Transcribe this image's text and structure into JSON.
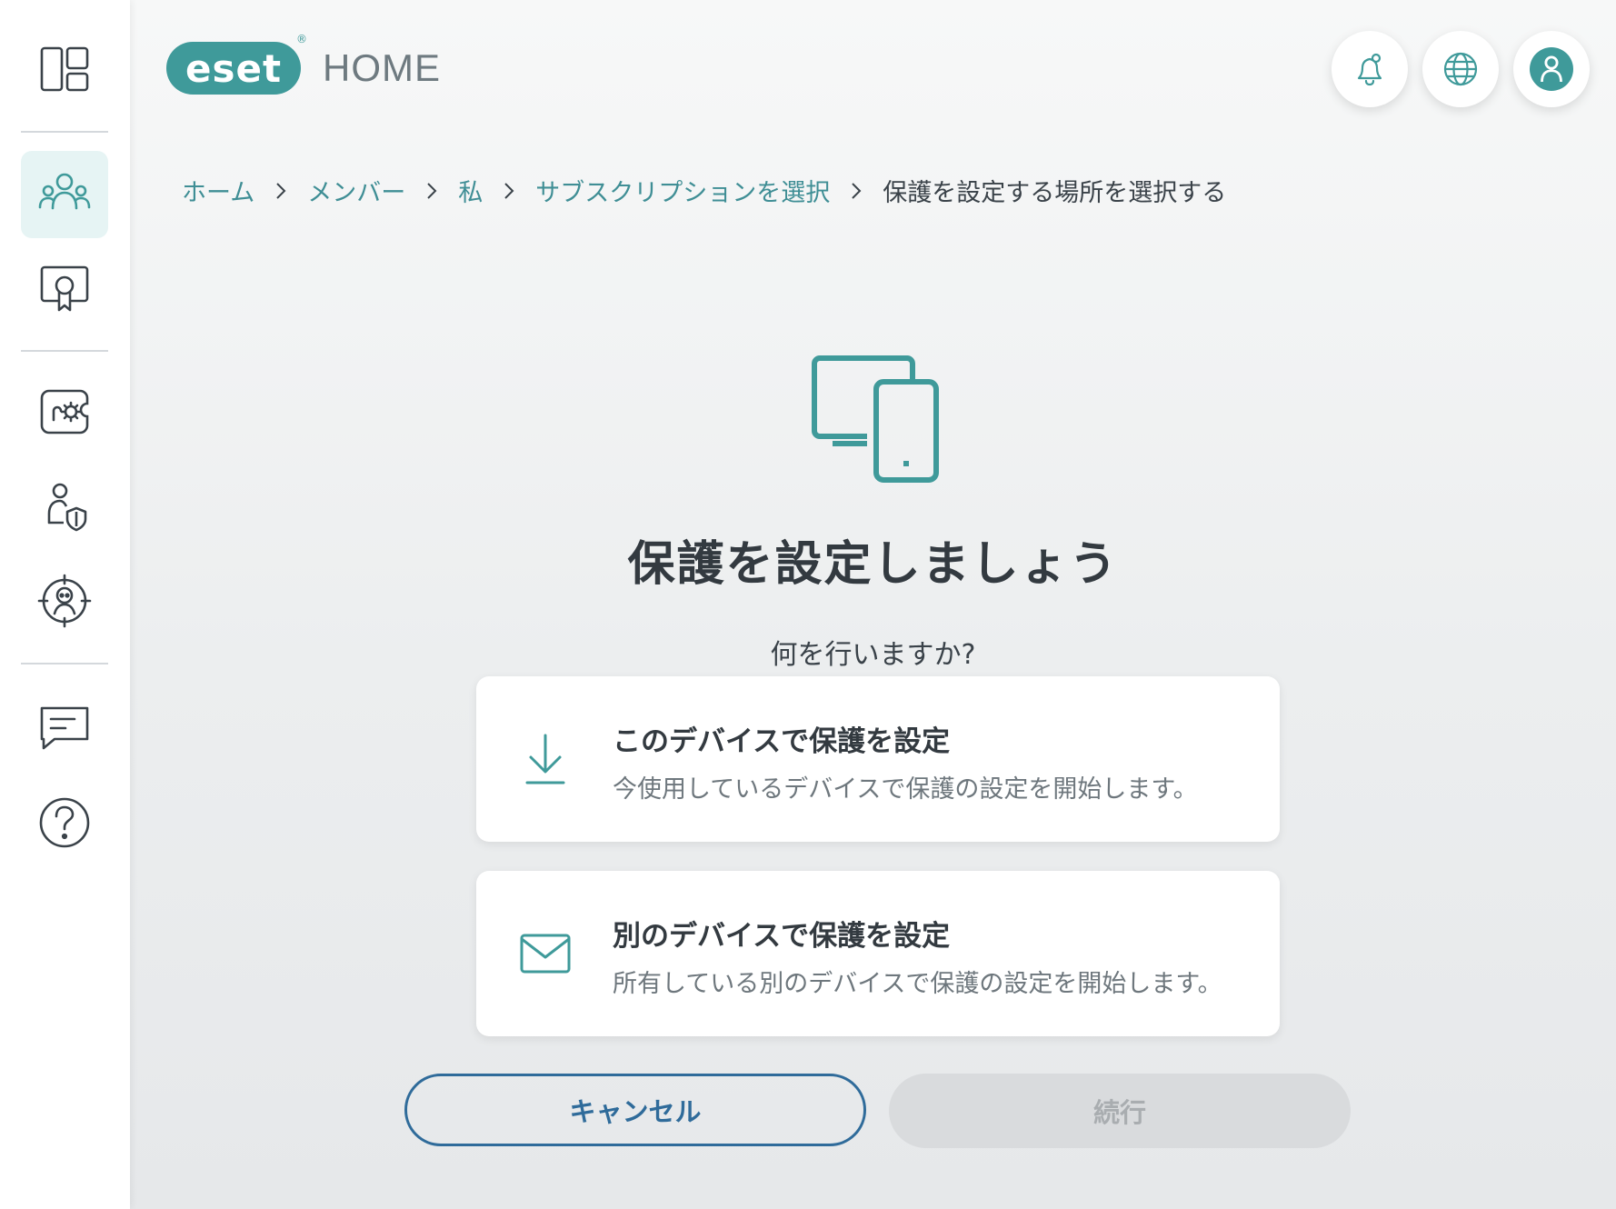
{
  "logo": {
    "brand": "eset",
    "registered": "®",
    "product": "HOME"
  },
  "colors": {
    "accent": "#3f9a9a",
    "link": "#3f8e95",
    "primary_outline": "#2f6b9a",
    "disabled_bg": "#d9dbdd"
  },
  "sidebar": {
    "items": [
      {
        "icon": "dashboard-icon"
      },
      {
        "icon": "family-members-icon",
        "active": true
      },
      {
        "icon": "license-certificate-icon"
      },
      {
        "icon": "security-features-icon"
      },
      {
        "icon": "user-shield-icon"
      },
      {
        "icon": "identity-protection-icon"
      },
      {
        "icon": "chat-feedback-icon"
      },
      {
        "icon": "help-icon"
      }
    ]
  },
  "header": {
    "notifications_icon": "bell-icon",
    "language_icon": "globe-icon",
    "account_icon": "user-icon"
  },
  "breadcrumb": {
    "items": [
      "ホーム",
      "メンバー",
      "私",
      "サブスクリプションを選択",
      "保護を設定する場所を選択する"
    ]
  },
  "main": {
    "hero_icon": "devices-icon",
    "title": "保護を設定しましょう",
    "question": "何を行いますか?",
    "options": [
      {
        "icon": "download-icon",
        "title": "このデバイスで保護を設定",
        "description": "今使用しているデバイスで保護の設定を開始します。"
      },
      {
        "icon": "mail-icon",
        "title": "別のデバイスで保護を設定",
        "description": "所有している別のデバイスで保護の設定を開始します。"
      }
    ],
    "cancel_label": "キャンセル",
    "continue_label": "続行"
  }
}
